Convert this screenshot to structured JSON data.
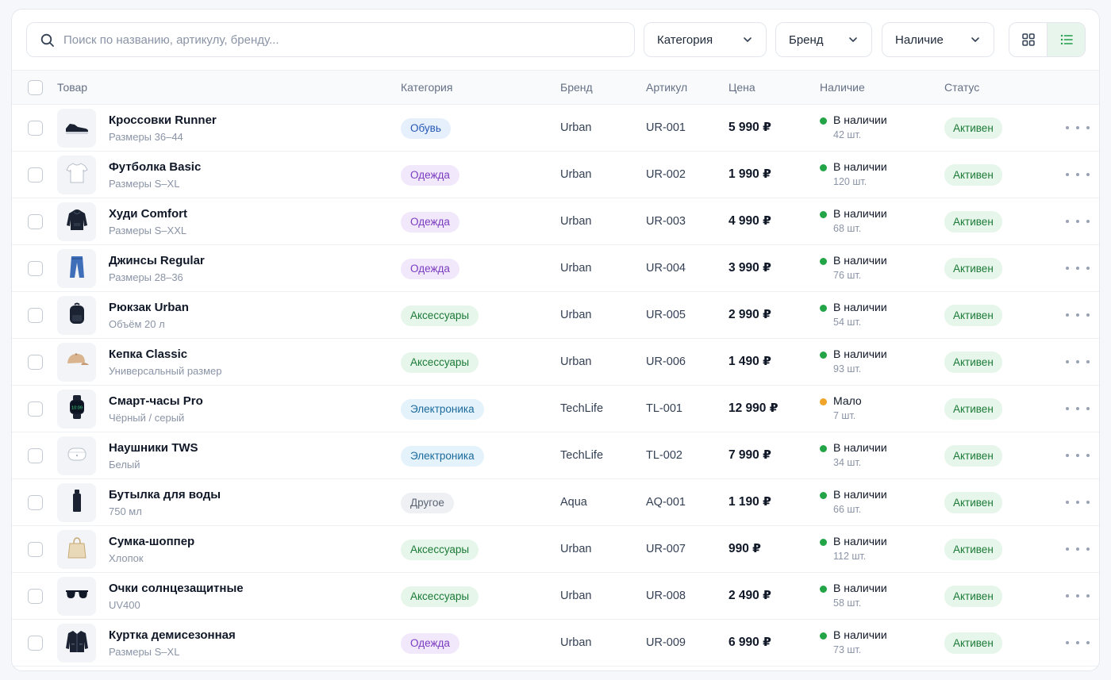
{
  "search": {
    "placeholder": "Поиск по названию, артикулу, бренду..."
  },
  "filters": [
    {
      "label": "Категория"
    },
    {
      "label": "Бренд"
    },
    {
      "label": "Наличие"
    }
  ],
  "view_toggle": {
    "active": "list"
  },
  "columns": {
    "product": "Товар",
    "category": "Категория",
    "brand": "Бренд",
    "sku": "Артикул",
    "price": "Цена",
    "stock": "Наличие",
    "status": "Статус"
  },
  "category_colors": {
    "Обувь": {
      "bg": "#e6effc",
      "fg": "#2457b5"
    },
    "Одежда": {
      "bg": "#f1e8fb",
      "fg": "#7a3bbf"
    },
    "Аксессуары": {
      "bg": "#e6f6ea",
      "fg": "#1b7a37"
    },
    "Электроника": {
      "bg": "#e3f2fb",
      "fg": "#1b6a9c"
    },
    "Другое": {
      "bg": "#eef0f3",
      "fg": "#5b6474"
    }
  },
  "stock_colors": {
    "ok": "#22a447",
    "low": "#f0a429"
  },
  "rows": [
    {
      "name": "Кроссовки Runner",
      "sub": "Размеры 36–44",
      "icon": "sneaker-icon",
      "category": "Обувь",
      "brand": "Urban",
      "sku": "UR-001",
      "price": "5 990 ₽",
      "stock": "В наличии",
      "stock_level": "ok",
      "qty": "42 шт.",
      "status": "Активен"
    },
    {
      "name": "Футболка Basic",
      "sub": "Размеры S–XL",
      "icon": "tshirt-icon",
      "category": "Одежда",
      "brand": "Urban",
      "sku": "UR-002",
      "price": "1 990 ₽",
      "stock": "В наличии",
      "stock_level": "ok",
      "qty": "120 шт.",
      "status": "Активен"
    },
    {
      "name": "Худи Comfort",
      "sub": "Размеры S–XXL",
      "icon": "hoodie-icon",
      "category": "Одежда",
      "brand": "Urban",
      "sku": "UR-003",
      "price": "4 990 ₽",
      "stock": "В наличии",
      "stock_level": "ok",
      "qty": "68 шт.",
      "status": "Активен"
    },
    {
      "name": "Джинсы Regular",
      "sub": "Размеры 28–36",
      "icon": "jeans-icon",
      "category": "Одежда",
      "brand": "Urban",
      "sku": "UR-004",
      "price": "3 990 ₽",
      "stock": "В наличии",
      "stock_level": "ok",
      "qty": "76 шт.",
      "status": "Активен"
    },
    {
      "name": "Рюкзак Urban",
      "sub": "Объём 20 л",
      "icon": "backpack-icon",
      "category": "Аксессуары",
      "brand": "Urban",
      "sku": "UR-005",
      "price": "2 990 ₽",
      "stock": "В наличии",
      "stock_level": "ok",
      "qty": "54 шт.",
      "status": "Активен"
    },
    {
      "name": "Кепка Classic",
      "sub": "Универсальный размер",
      "icon": "cap-icon",
      "category": "Аксессуары",
      "brand": "Urban",
      "sku": "UR-006",
      "price": "1 490 ₽",
      "stock": "В наличии",
      "stock_level": "ok",
      "qty": "93 шт.",
      "status": "Активен"
    },
    {
      "name": "Смарт-часы Pro",
      "sub": "Чёрный / серый",
      "icon": "smartwatch-icon",
      "watch_time": "10:09",
      "category": "Электроника",
      "brand": "TechLife",
      "sku": "TL-001",
      "price": "12 990 ₽",
      "stock": "Мало",
      "stock_level": "low",
      "qty": "7 шт.",
      "status": "Активен"
    },
    {
      "name": "Наушники TWS",
      "sub": "Белый",
      "icon": "earbuds-icon",
      "category": "Электроника",
      "brand": "TechLife",
      "sku": "TL-002",
      "price": "7 990 ₽",
      "stock": "В наличии",
      "stock_level": "ok",
      "qty": "34 шт.",
      "status": "Активен"
    },
    {
      "name": "Бутылка для воды",
      "sub": "750 мл",
      "icon": "bottle-icon",
      "category": "Другое",
      "brand": "Aqua",
      "sku": "AQ-001",
      "price": "1 190 ₽",
      "stock": "В наличии",
      "stock_level": "ok",
      "qty": "66 шт.",
      "status": "Активен"
    },
    {
      "name": "Сумка-шоппер",
      "sub": "Хлопок",
      "icon": "tote-bag-icon",
      "category": "Аксессуары",
      "brand": "Urban",
      "sku": "UR-007",
      "price": "990 ₽",
      "stock": "В наличии",
      "stock_level": "ok",
      "qty": "112 шт.",
      "status": "Активен"
    },
    {
      "name": "Очки солнцезащитные",
      "sub": "UV400",
      "icon": "sunglasses-icon",
      "category": "Аксессуары",
      "brand": "Urban",
      "sku": "UR-008",
      "price": "2 490 ₽",
      "stock": "В наличии",
      "stock_level": "ok",
      "qty": "58 шт.",
      "status": "Активен"
    },
    {
      "name": "Куртка демисезонная",
      "sub": "Размеры S–XL",
      "icon": "jacket-icon",
      "category": "Одежда",
      "brand": "Urban",
      "sku": "UR-009",
      "price": "6 990 ₽",
      "stock": "В наличии",
      "stock_level": "ok",
      "qty": "73 шт.",
      "status": "Активен"
    }
  ]
}
